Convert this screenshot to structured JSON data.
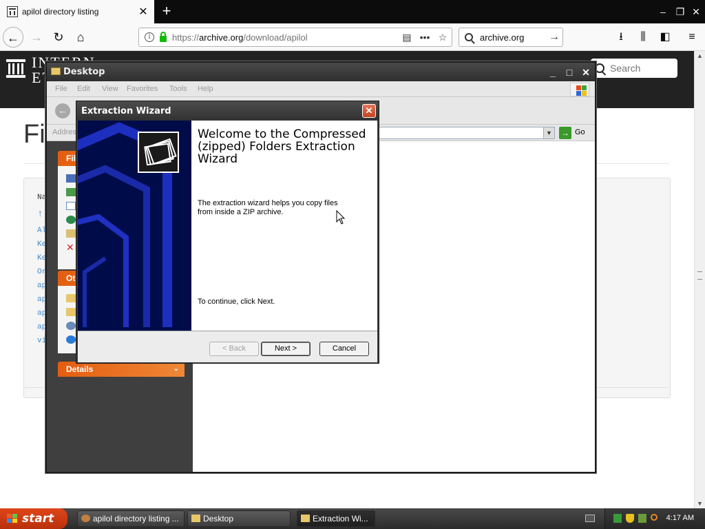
{
  "browser": {
    "tab_title": "apilol directory listing",
    "url_prefix": "https://",
    "url_host": "archive.org",
    "url_path": "/download/apilol",
    "search_engine_text": "archive.org"
  },
  "page": {
    "logo_text": "INTERNET AR",
    "search_placeholder": "Search",
    "heading": "Fil",
    "listing_fragments": [
      "Na",
      "↑",
      "Al",
      "Ke",
      "Ke",
      "Or",
      "ap",
      "ap",
      "ap",
      "ap",
      "vi"
    ]
  },
  "explorer": {
    "title": "Desktop",
    "menu": [
      "File",
      "Edit",
      "View",
      "Favorites",
      "Tools",
      "Help"
    ],
    "address_label": "Address",
    "go_label": "Go",
    "taskpane": {
      "file_tasks_header": "File",
      "other_places_header": "Oth",
      "details_header": "Details"
    }
  },
  "wizard": {
    "title": "Extraction Wizard",
    "heading": "Welcome to the Compressed (zipped) Folders Extraction Wizard",
    "description": "The extraction wizard helps you copy files from inside a ZIP archive.",
    "continue_text": "To continue, click Next.",
    "back_label": "< Back",
    "next_label": "Next >",
    "cancel_label": "Cancel"
  },
  "taskbar": {
    "start_label": "start",
    "tasks": [
      "apilol directory listing ...",
      "Desktop",
      "Extraction Wi..."
    ],
    "clock": "4:17 AM"
  },
  "colors": {
    "firefox_tabbar": "#0c0c0d",
    "ia_header": "#222222",
    "xp_start": "#e0461a",
    "wizard_side": "#000c4a",
    "taskpane_header": "#e35d10"
  }
}
